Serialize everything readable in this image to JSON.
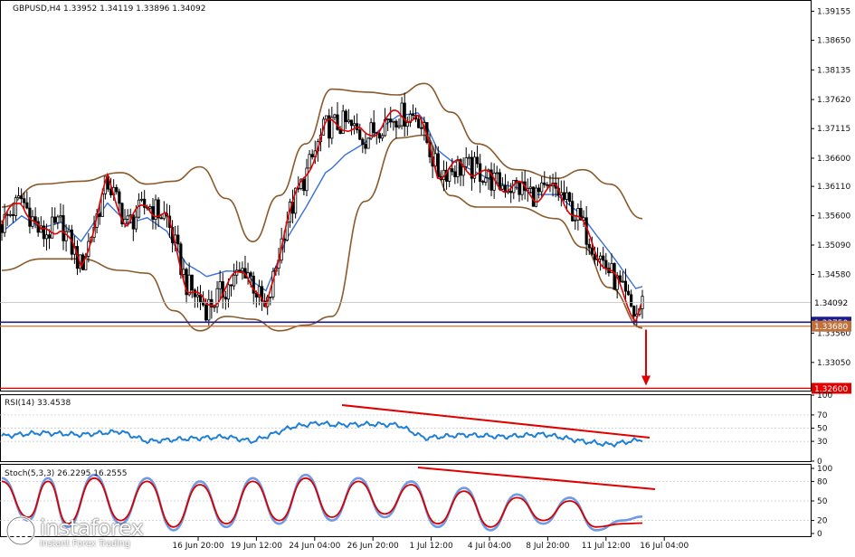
{
  "header": {
    "symbol_line": "GBPUSD,H4  1.33952 1.34119 1.33896 1.34092"
  },
  "price_axis": {
    "ticks": [
      "1.39155",
      "1.38650",
      "1.38135",
      "1.37620",
      "1.37115",
      "1.36600",
      "1.36110",
      "1.35600",
      "1.35090",
      "1.34580",
      "1.33560",
      "1.33050"
    ],
    "tick_values": [
      1.39155,
      1.3865,
      1.38135,
      1.3762,
      1.37115,
      1.366,
      1.3611,
      1.356,
      1.3509,
      1.3458,
      1.3356,
      1.3305
    ],
    "current_price": "1.34092",
    "level_blue": "1.33750",
    "level_orange": "1.33680",
    "target_level": "1.32600"
  },
  "time_axis": {
    "labels": [
      "16 Jun 20:00",
      "19 Jun 12:00",
      "24 Jun 04:00",
      "26 Jun 20:00",
      "1 Jul 12:00",
      "4 Jul 04:00",
      "8 Jul 20:00",
      "11 Jul 12:00",
      "16 Jul 04:00"
    ]
  },
  "rsi_panel": {
    "title": "RSI(14) 33.4538",
    "ticks": [
      "100",
      "70",
      "50",
      "30",
      "0"
    ],
    "tick_values": [
      100,
      70,
      50,
      30,
      0
    ]
  },
  "stoch_panel": {
    "title": "Stoch(5,3,3) 26.2295 16.2555",
    "ticks": [
      "100",
      "80",
      "50",
      "20",
      "0"
    ],
    "tick_values": [
      100,
      80,
      50,
      20,
      0
    ]
  },
  "logo": {
    "brand": "instaforex",
    "tagline": "Instant Forex Trading"
  },
  "colors": {
    "candle": "#000000",
    "ma_fast": "#e00000",
    "ma_slow": "#3a6fd8",
    "bollinger": "#8b5a2b",
    "rsi_line": "#1f7fd6",
    "stoch_main": "#6f9ae6",
    "stoch_signal": "#d40000",
    "level_blue": "#1b1b8a",
    "level_orange": "#c0703a",
    "target": "#e00000",
    "trendline": "#e00000"
  },
  "chart_data": [
    {
      "type": "candlestick",
      "title": "GBPUSD,H4",
      "ohlc_last": {
        "open": 1.33952,
        "high": 1.34119,
        "low": 1.33896,
        "close": 1.34092
      },
      "ylim": [
        1.3256,
        1.3935
      ],
      "x_labels": [
        "16 Jun 20:00",
        "19 Jun 12:00",
        "24 Jun 04:00",
        "26 Jun 20:00",
        "1 Jul 12:00",
        "4 Jul 04:00",
        "8 Jul 20:00",
        "11 Jul 12:00",
        "16 Jul 04:00"
      ],
      "close_path": [
        {
          "x": 0,
          "y": 1.3545
        },
        {
          "x": 3,
          "y": 1.359
        },
        {
          "x": 6,
          "y": 1.3525
        },
        {
          "x": 9,
          "y": 1.3545
        },
        {
          "x": 12,
          "y": 1.347
        },
        {
          "x": 16,
          "y": 1.362
        },
        {
          "x": 19,
          "y": 1.3545
        },
        {
          "x": 22,
          "y": 1.358
        },
        {
          "x": 25,
          "y": 1.3555
        },
        {
          "x": 28,
          "y": 1.344
        },
        {
          "x": 31,
          "y": 1.34
        },
        {
          "x": 34,
          "y": 1.3435
        },
        {
          "x": 37,
          "y": 1.347
        },
        {
          "x": 40,
          "y": 1.339
        },
        {
          "x": 43,
          "y": 1.355
        },
        {
          "x": 46,
          "y": 1.363
        },
        {
          "x": 49,
          "y": 1.3715
        },
        {
          "x": 52,
          "y": 1.372
        },
        {
          "x": 55,
          "y": 1.3695
        },
        {
          "x": 58,
          "y": 1.3725
        },
        {
          "x": 60,
          "y": 1.3735
        },
        {
          "x": 63,
          "y": 1.3735
        },
        {
          "x": 66,
          "y": 1.3635
        },
        {
          "x": 69,
          "y": 1.3645
        },
        {
          "x": 72,
          "y": 1.364
        },
        {
          "x": 75,
          "y": 1.3615
        },
        {
          "x": 78,
          "y": 1.361
        },
        {
          "x": 81,
          "y": 1.3595
        },
        {
          "x": 84,
          "y": 1.3605
        },
        {
          "x": 87,
          "y": 1.356
        },
        {
          "x": 90,
          "y": 1.35
        },
        {
          "x": 93,
          "y": 1.3445
        },
        {
          "x": 96,
          "y": 1.3385
        },
        {
          "x": 97,
          "y": 1.3409
        }
      ],
      "bollinger_upper": [
        {
          "x": 0,
          "y": 1.3575
        },
        {
          "x": 6,
          "y": 1.3615
        },
        {
          "x": 12,
          "y": 1.362
        },
        {
          "x": 18,
          "y": 1.3635
        },
        {
          "x": 22,
          "y": 1.3615
        },
        {
          "x": 26,
          "y": 1.362
        },
        {
          "x": 30,
          "y": 1.3645
        },
        {
          "x": 34,
          "y": 1.359
        },
        {
          "x": 38,
          "y": 1.3515
        },
        {
          "x": 42,
          "y": 1.3595
        },
        {
          "x": 46,
          "y": 1.3685
        },
        {
          "x": 50,
          "y": 1.378
        },
        {
          "x": 55,
          "y": 1.3775
        },
        {
          "x": 60,
          "y": 1.377
        },
        {
          "x": 64,
          "y": 1.379
        },
        {
          "x": 68,
          "y": 1.374
        },
        {
          "x": 72,
          "y": 1.3685
        },
        {
          "x": 78,
          "y": 1.364
        },
        {
          "x": 84,
          "y": 1.3625
        },
        {
          "x": 88,
          "y": 1.364
        },
        {
          "x": 92,
          "y": 1.3615
        },
        {
          "x": 97,
          "y": 1.3555
        }
      ],
      "bollinger_lower": [
        {
          "x": 0,
          "y": 1.3465
        },
        {
          "x": 6,
          "y": 1.3485
        },
        {
          "x": 12,
          "y": 1.3485
        },
        {
          "x": 18,
          "y": 1.3465
        },
        {
          "x": 22,
          "y": 1.346
        },
        {
          "x": 26,
          "y": 1.3395
        },
        {
          "x": 30,
          "y": 1.336
        },
        {
          "x": 34,
          "y": 1.3385
        },
        {
          "x": 38,
          "y": 1.338
        },
        {
          "x": 42,
          "y": 1.336
        },
        {
          "x": 46,
          "y": 1.337
        },
        {
          "x": 50,
          "y": 1.3385
        },
        {
          "x": 55,
          "y": 1.3585
        },
        {
          "x": 60,
          "y": 1.3695
        },
        {
          "x": 64,
          "y": 1.37
        },
        {
          "x": 68,
          "y": 1.3595
        },
        {
          "x": 72,
          "y": 1.3575
        },
        {
          "x": 78,
          "y": 1.3575
        },
        {
          "x": 84,
          "y": 1.3555
        },
        {
          "x": 88,
          "y": 1.3505
        },
        {
          "x": 92,
          "y": 1.3435
        },
        {
          "x": 97,
          "y": 1.3365
        }
      ],
      "horizontal_levels": [
        1.3375,
        1.3368,
        1.326
      ]
    },
    {
      "type": "line",
      "title": "RSI(14) 33.4538",
      "ylim": [
        0,
        100
      ],
      "values": [
        {
          "x": 0,
          "y": 38
        },
        {
          "x": 6,
          "y": 43
        },
        {
          "x": 12,
          "y": 40
        },
        {
          "x": 18,
          "y": 45
        },
        {
          "x": 22,
          "y": 30
        },
        {
          "x": 28,
          "y": 34
        },
        {
          "x": 34,
          "y": 37
        },
        {
          "x": 38,
          "y": 30
        },
        {
          "x": 44,
          "y": 52
        },
        {
          "x": 48,
          "y": 58
        },
        {
          "x": 50,
          "y": 55
        },
        {
          "x": 56,
          "y": 56
        },
        {
          "x": 60,
          "y": 55
        },
        {
          "x": 64,
          "y": 35
        },
        {
          "x": 70,
          "y": 40
        },
        {
          "x": 76,
          "y": 37
        },
        {
          "x": 82,
          "y": 41
        },
        {
          "x": 88,
          "y": 30
        },
        {
          "x": 92,
          "y": 25
        },
        {
          "x": 97,
          "y": 33
        }
      ]
    },
    {
      "type": "line",
      "title": "Stoch(5,3,3) 26.2295 16.2555",
      "ylim": [
        0,
        100
      ],
      "main": [
        {
          "x": 0,
          "y": 85
        },
        {
          "x": 4,
          "y": 20
        },
        {
          "x": 7,
          "y": 85
        },
        {
          "x": 10,
          "y": 10
        },
        {
          "x": 14,
          "y": 90
        },
        {
          "x": 18,
          "y": 15
        },
        {
          "x": 22,
          "y": 85
        },
        {
          "x": 26,
          "y": 5
        },
        {
          "x": 30,
          "y": 80
        },
        {
          "x": 34,
          "y": 10
        },
        {
          "x": 38,
          "y": 85
        },
        {
          "x": 42,
          "y": 15
        },
        {
          "x": 46,
          "y": 90
        },
        {
          "x": 50,
          "y": 20
        },
        {
          "x": 54,
          "y": 85
        },
        {
          "x": 58,
          "y": 25
        },
        {
          "x": 62,
          "y": 80
        },
        {
          "x": 66,
          "y": 10
        },
        {
          "x": 70,
          "y": 70
        },
        {
          "x": 74,
          "y": 5
        },
        {
          "x": 78,
          "y": 60
        },
        {
          "x": 82,
          "y": 15
        },
        {
          "x": 86,
          "y": 55
        },
        {
          "x": 90,
          "y": 5
        },
        {
          "x": 94,
          "y": 20
        },
        {
          "x": 97,
          "y": 26
        }
      ],
      "signal": [
        {
          "x": 0,
          "y": 80
        },
        {
          "x": 4,
          "y": 25
        },
        {
          "x": 7,
          "y": 80
        },
        {
          "x": 10,
          "y": 15
        },
        {
          "x": 14,
          "y": 85
        },
        {
          "x": 18,
          "y": 20
        },
        {
          "x": 22,
          "y": 80
        },
        {
          "x": 26,
          "y": 10
        },
        {
          "x": 30,
          "y": 75
        },
        {
          "x": 34,
          "y": 15
        },
        {
          "x": 38,
          "y": 80
        },
        {
          "x": 42,
          "y": 20
        },
        {
          "x": 46,
          "y": 85
        },
        {
          "x": 50,
          "y": 25
        },
        {
          "x": 54,
          "y": 80
        },
        {
          "x": 58,
          "y": 30
        },
        {
          "x": 62,
          "y": 75
        },
        {
          "x": 66,
          "y": 15
        },
        {
          "x": 70,
          "y": 65
        },
        {
          "x": 74,
          "y": 10
        },
        {
          "x": 78,
          "y": 55
        },
        {
          "x": 82,
          "y": 20
        },
        {
          "x": 86,
          "y": 50
        },
        {
          "x": 90,
          "y": 10
        },
        {
          "x": 94,
          "y": 15
        },
        {
          "x": 97,
          "y": 16
        }
      ]
    }
  ]
}
